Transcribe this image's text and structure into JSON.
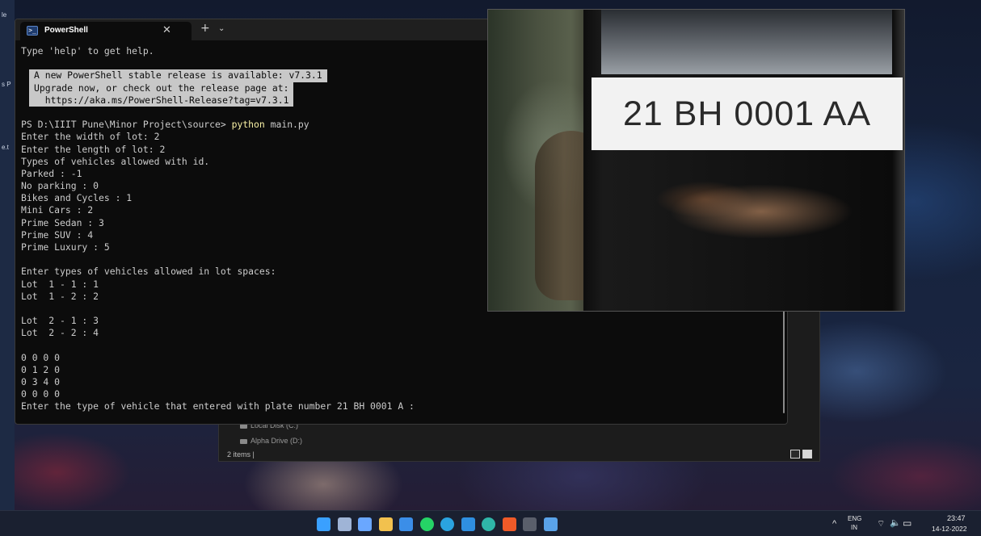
{
  "desktop": {
    "edge_labels": [
      "le",
      "s P",
      "e.t"
    ]
  },
  "explorer": {
    "drives": [
      "Local Disk (C:)",
      "Alpha Drive (D:)"
    ],
    "status": "2 items  |"
  },
  "terminal": {
    "tab_title": "PowerShell",
    "tab_icon_glyph": ">_",
    "close_glyph": "✕",
    "new_tab_glyph": "+",
    "dropdown_glyph": "⌄",
    "lines": [
      "Type 'help' to get help.",
      "",
      "__NOTICE__",
      "__NOTICE__",
      "__NOTICE__",
      "",
      "__PROMPT__",
      "Enter the width of lot: 2",
      "Enter the length of lot: 2",
      "Types of vehicles allowed with id.",
      "Parked : -1",
      "No parking : 0",
      "Bikes and Cycles : 1",
      "Mini Cars : 2",
      "Prime Sedan : 3",
      "Prime SUV : 4",
      "Prime Luxury : 5",
      "",
      "Enter types of vehicles allowed in lot spaces:",
      "Lot  1 - 1 : 1",
      "Lot  1 - 2 : 2",
      "",
      "Lot  2 - 1 : 3",
      "Lot  2 - 2 : 4",
      "",
      "0 0 0 0",
      "0 1 2 0",
      "0 3 4 0",
      "0 0 0 0",
      "Enter the type of vehicle that entered with plate number 21 BH 0001 A :"
    ],
    "notice_lines": [
      "A new PowerShell stable release is available: v7.3.1",
      "Upgrade now, or check out the release page at:",
      "  https://aka.ms/PowerShell-Release?tag=v7.3.1"
    ],
    "prompt": {
      "path": "PS D:\\IIIT Pune\\Minor Project\\source> ",
      "command": "python",
      "args": " main.py"
    },
    "colors": {
      "background": "#0c0c0c",
      "text": "#cccccc",
      "command": "#f9f1a5"
    }
  },
  "camera": {
    "plate_text": "21 BH 0001 AA"
  },
  "taskbar": {
    "icons": [
      {
        "name": "start-icon",
        "color": "#3aa0ff"
      },
      {
        "name": "task-view-icon",
        "color": "#9fb4d6"
      },
      {
        "name": "store-icon",
        "color": "#6aa7ff"
      },
      {
        "name": "file-explorer-icon",
        "color": "#f2c14e"
      },
      {
        "name": "mail-icon",
        "color": "#3b8ee8"
      },
      {
        "name": "whatsapp-icon",
        "color": "#25d366"
      },
      {
        "name": "telegram-icon",
        "color": "#2aa3e0"
      },
      {
        "name": "vscode-icon",
        "color": "#2f8fe0"
      },
      {
        "name": "edge-icon",
        "color": "#2fb6a8"
      },
      {
        "name": "brave-icon",
        "color": "#f05a28"
      },
      {
        "name": "terminal-icon",
        "color": "#5a5f6b"
      },
      {
        "name": "photos-icon",
        "color": "#5aa2e8"
      }
    ],
    "tray": {
      "chevron": "^",
      "lang_top": "ENG",
      "lang_bottom": "IN",
      "wifi": "⌔",
      "volume": "🔈",
      "battery": "▭",
      "time": "23:47",
      "date": "14-12-2022"
    }
  }
}
